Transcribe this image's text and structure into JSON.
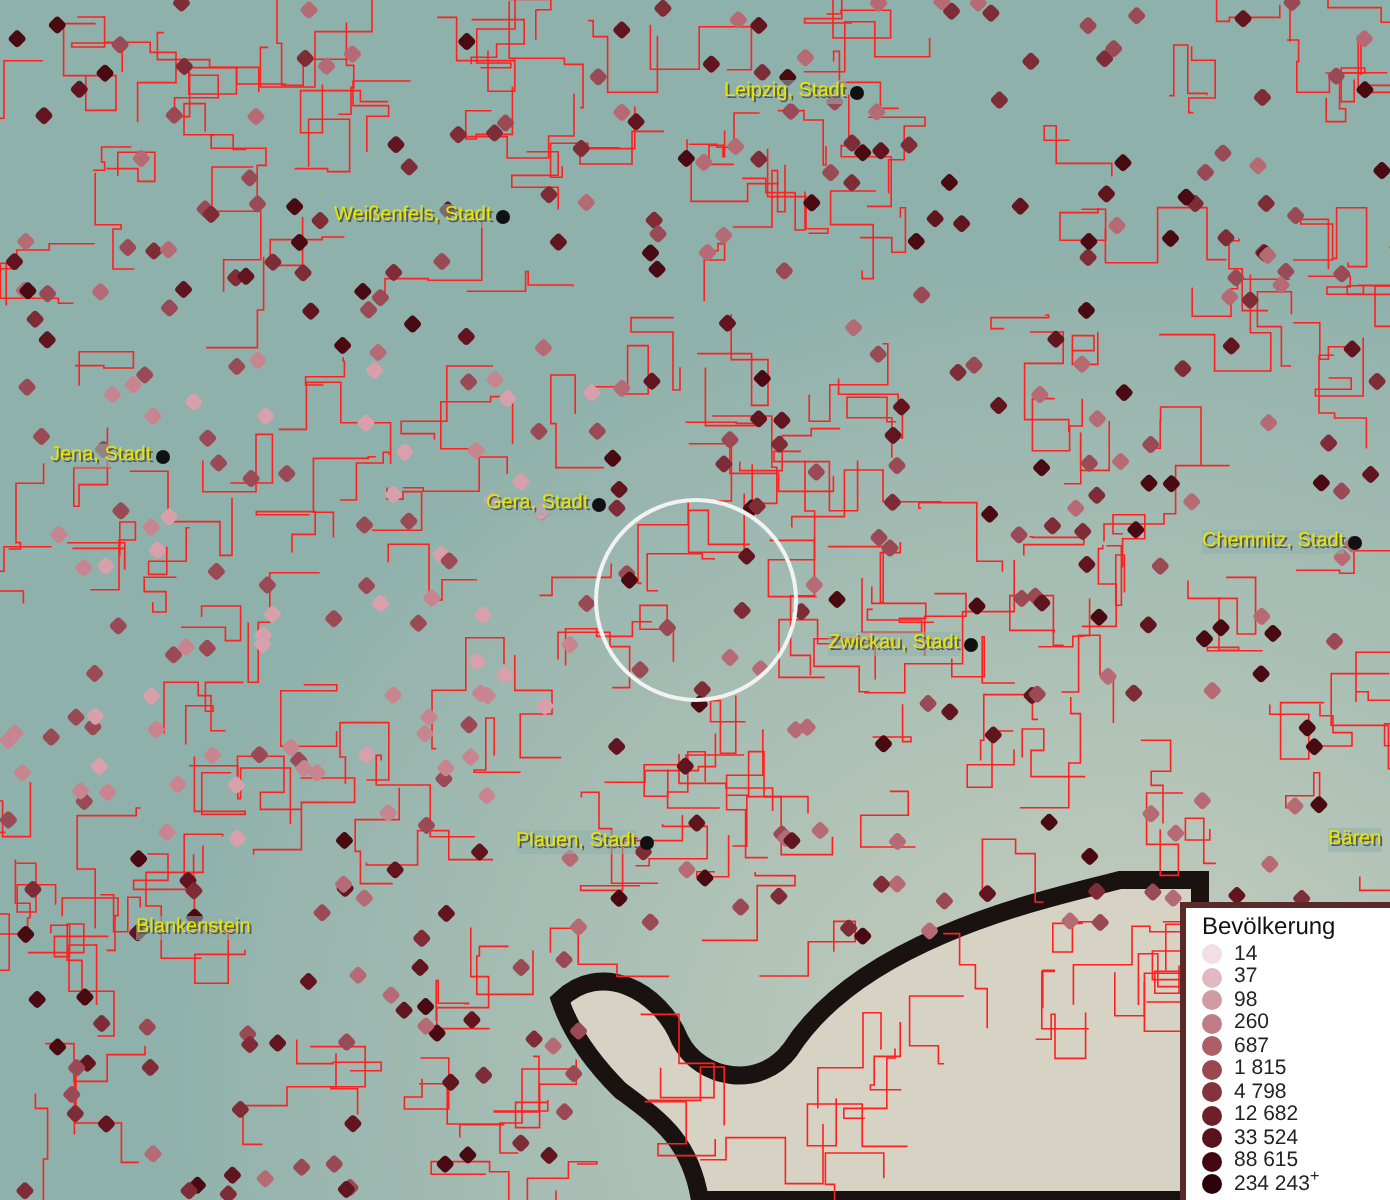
{
  "map": {
    "places": [
      {
        "name": "Leipzig, Stadt",
        "kind": "city"
      },
      {
        "name": "Weißenfels, Stadt",
        "kind": "city"
      },
      {
        "name": "Jena, Stadt",
        "kind": "city"
      },
      {
        "name": "Gera, Stadt",
        "kind": "city"
      },
      {
        "name": "Chemnitz, Stadt",
        "kind": "city"
      },
      {
        "name": "Zwickau, Stadt",
        "kind": "city"
      },
      {
        "name": "Plauen, Stadt",
        "kind": "city"
      },
      {
        "name": "Blankenstein",
        "kind": "town"
      },
      {
        "name": "Bären",
        "kind": "town"
      }
    ]
  },
  "legend": {
    "title": "Bevölkerung",
    "items": [
      {
        "label": "14",
        "color": "#f3dde6"
      },
      {
        "label": "37",
        "color": "#e2b9c2"
      },
      {
        "label": "98",
        "color": "#d09aa2"
      },
      {
        "label": "260",
        "color": "#bf7c84"
      },
      {
        "label": "687",
        "color": "#ad5f67"
      },
      {
        "label": "1 815",
        "color": "#994850"
      },
      {
        "label": "4 798",
        "color": "#84333c"
      },
      {
        "label": "12 682",
        "color": "#6e2029"
      },
      {
        "label": "33 524",
        "color": "#58121b"
      },
      {
        "label": "88 615",
        "color": "#420811"
      },
      {
        "label": "234 243$^{+}$",
        "color": "#2c0308"
      }
    ]
  }
}
